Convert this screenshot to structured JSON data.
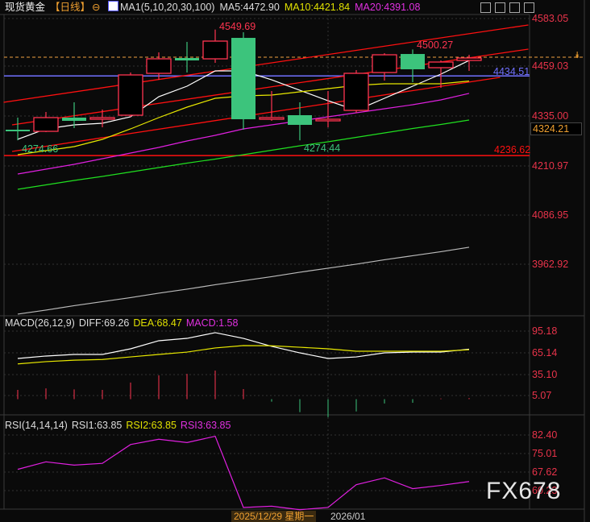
{
  "header": {
    "symbol": "现货黄金",
    "period": "【日线】",
    "ma_label": "MA1(5,10,20,30,100)",
    "ma5": "MA5:4472.90",
    "ma10": "MA10:4421.84",
    "ma20": "MA20:4391.08",
    "toolbar_icons": [
      "grid-icon",
      "bar-chart-icon",
      "line-tool-icon",
      "forward-icon"
    ]
  },
  "colors": {
    "up": "#ff3450",
    "down": "#3cc47c",
    "ma5": "#ffffff",
    "ma10": "#e8e800",
    "ma20": "#e020e0",
    "ma30": "#20e020",
    "ma100": "#bbbbbb",
    "trend": "#ff1010",
    "axis": "#e8334a",
    "blue_line": "#7070ff",
    "orange_line": "#f0a040"
  },
  "chart_data": [
    {
      "type": "candlestick",
      "title": "现货黄金 【日线】",
      "y_ticks": [
        "4583.05",
        "4459.03",
        "4335.00",
        "4210.97",
        "4086.95",
        "3962.92"
      ],
      "ylim": [
        3900,
        4600
      ],
      "x_labels": [
        "2025/12/29 星期一",
        "2026/01"
      ],
      "candles": [
        {
          "o": 4301,
          "h": 4331,
          "l": 4274.66,
          "c": 4299
        },
        {
          "o": 4297,
          "h": 4345,
          "l": 4295,
          "c": 4331
        },
        {
          "o": 4331,
          "h": 4369,
          "l": 4305,
          "c": 4323
        },
        {
          "o": 4327,
          "h": 4351,
          "l": 4307,
          "c": 4331
        },
        {
          "o": 4337,
          "h": 4443,
          "l": 4333,
          "c": 4437
        },
        {
          "o": 4441,
          "h": 4493,
          "l": 4425,
          "c": 4477
        },
        {
          "o": 4479,
          "h": 4519,
          "l": 4443,
          "c": 4473
        },
        {
          "o": 4477,
          "h": 4549.69,
          "l": 4467,
          "c": 4521
        },
        {
          "o": 4529,
          "h": 4543,
          "l": 4301,
          "c": 4327
        },
        {
          "o": 4327,
          "h": 4397,
          "l": 4323,
          "c": 4331
        },
        {
          "o": 4337,
          "h": 4369,
          "l": 4274.44,
          "c": 4313
        },
        {
          "o": 4323,
          "h": 4397,
          "l": 4307,
          "c": 4327
        },
        {
          "o": 4349,
          "h": 4449,
          "l": 4343,
          "c": 4441
        },
        {
          "o": 4443,
          "h": 4491,
          "l": 4423,
          "c": 4487
        },
        {
          "o": 4489,
          "h": 4500.27,
          "l": 4419,
          "c": 4451
        },
        {
          "o": 4455,
          "h": 4473,
          "l": 4405,
          "c": 4469
        },
        {
          "o": 4473,
          "h": 4487,
          "l": 4447,
          "c": 4479
        }
      ],
      "series": [
        {
          "name": "MA5",
          "values": [
            4277,
            4303,
            4313,
            4317,
            4333,
            4383,
            4409,
            4447,
            4447,
            4425,
            4399,
            4373,
            4349,
            4379,
            4409,
            4439,
            4472.9
          ]
        },
        {
          "name": "MA10",
          "values": [
            4239,
            4249,
            4259,
            4277,
            4303,
            4331,
            4357,
            4379,
            4385,
            4387,
            4395,
            4403,
            4411,
            4415,
            4415,
            4415,
            4421.84
          ]
        },
        {
          "name": "MA20",
          "values": [
            4191,
            4203,
            4215,
            4229,
            4243,
            4257,
            4273,
            4287,
            4303,
            4313,
            4323,
            4333,
            4343,
            4353,
            4363,
            4375,
            4391.08
          ]
        },
        {
          "name": "MA30",
          "values": [
            4153,
            4164,
            4175,
            4185,
            4196,
            4207,
            4218,
            4228,
            4239,
            4250,
            4261,
            4271,
            4282,
            4293,
            4304,
            4314,
            4325
          ]
        },
        {
          "name": "MA100",
          "values": [
            3843,
            3853,
            3864,
            3874,
            3884,
            3895,
            3905,
            3916,
            3926,
            3936,
            3947,
            3957,
            3967,
            3978,
            3988,
            3998,
            4009
          ]
        }
      ],
      "trend_lines": [
        {
          "from": [
            0.5,
            4369
          ],
          "to": [
            19.1,
            4561
          ]
        },
        {
          "from": [
            0.8,
            4313
          ],
          "to": [
            19.1,
            4501
          ]
        },
        {
          "from": [
            0.8,
            4247
          ],
          "to": [
            18.1,
            4431
          ]
        }
      ],
      "annotations": {
        "high_label": "4549.69",
        "high2_label": "4500.27",
        "low_label": "4274.66",
        "low2_label": "4274.44",
        "blue_line": "4434.51",
        "red_line": "4236.62",
        "orange_line": 4481,
        "cursor_price": "4324.21"
      }
    },
    {
      "type": "macd",
      "title": "MACD(26,12,9)",
      "diff_label": "DIFF:69.26",
      "dea_label": "DEA:68.47",
      "macd_label": "MACD:1.58",
      "y_ticks": [
        "95.18",
        "65.14",
        "35.10",
        "5.07"
      ],
      "diff": [
        56.4,
        59.8,
        62,
        62,
        69.8,
        81,
        84.3,
        92.2,
        84.3,
        73.2,
        64.2,
        56.4,
        58.6,
        64.2,
        65.3,
        65.3,
        69.26
      ],
      "dea": [
        48.9,
        52,
        54,
        55,
        58.6,
        62,
        65.3,
        71,
        74.3,
        74,
        72,
        69.8,
        66.5,
        66.5,
        66.5,
        66.5,
        68.47
      ],
      "macd": [
        12.8,
        15,
        13.6,
        12.8,
        23,
        33,
        35,
        39.7,
        14,
        -3.5,
        -18,
        -25,
        -17,
        -6,
        -5,
        1.0,
        1.58
      ]
    },
    {
      "type": "rsi",
      "title": "RSI(14,14,14)",
      "rsi1_label": "RSI1:63.85",
      "rsi2_label": "RSI2:63.85",
      "rsi3_label": "RSI3:63.85",
      "y_ticks": [
        "82.40",
        "75.01",
        "67.62",
        "60.23"
      ],
      "values": [
        68.7,
        71.7,
        70.4,
        71.1,
        78.6,
        80.7,
        79.4,
        81.9,
        53.5,
        54.0,
        52.6,
        53.5,
        62.6,
        65.3,
        61.0,
        62.3,
        63.85
      ]
    }
  ],
  "watermark": "FX678"
}
